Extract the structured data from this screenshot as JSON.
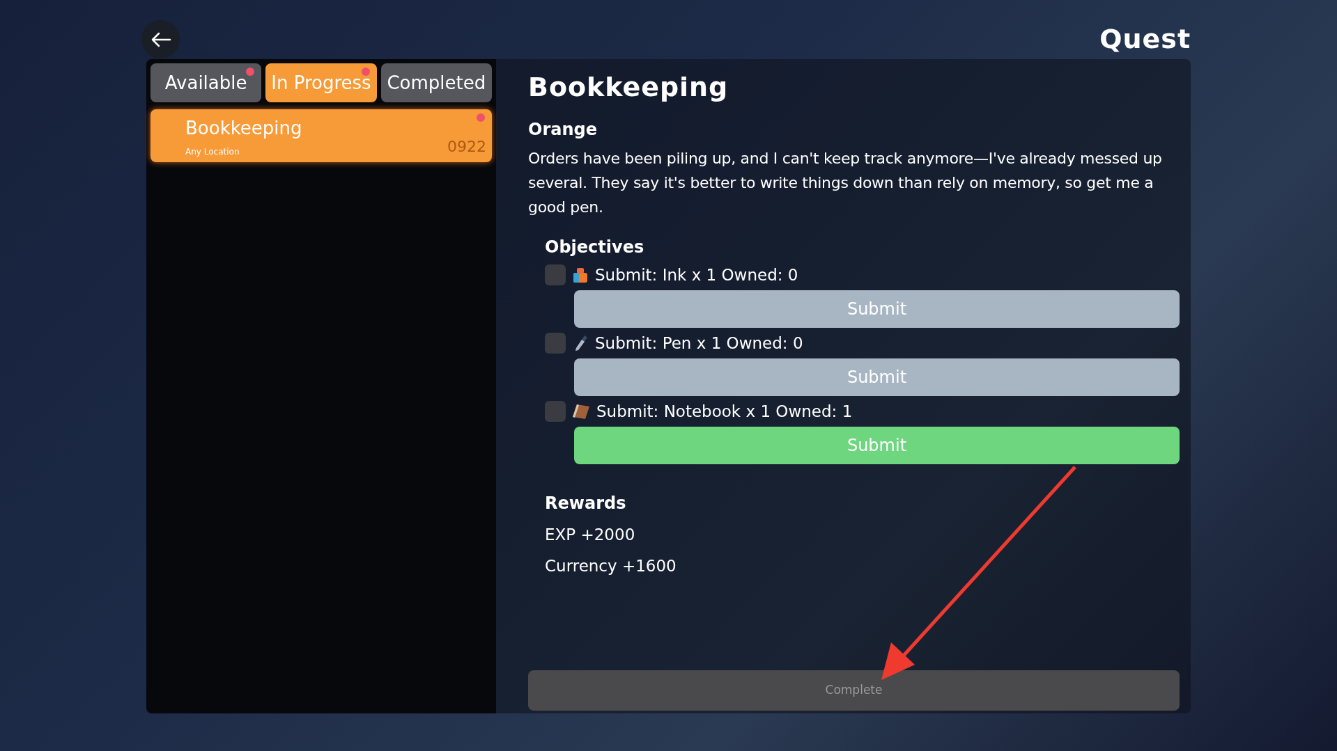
{
  "title": "Quest",
  "tabs": [
    {
      "label": "Available",
      "selected": false,
      "notification": true
    },
    {
      "label": "In Progress",
      "selected": true,
      "notification": true
    },
    {
      "label": "Completed",
      "selected": false,
      "notification": false
    }
  ],
  "quests": [
    {
      "name": "Bookkeeping",
      "location": "Any Location",
      "code": "0922",
      "selected": true,
      "notification": true
    }
  ],
  "detail": {
    "name": "Bookkeeping",
    "giver": "Orange",
    "description": "Orders have been piling up, and I can't keep track anymore—I've already messed up several. They say it's better to write things down than rely on memory, so get me a good pen.",
    "objectives_heading": "Objectives",
    "objectives": [
      {
        "kind": "ink",
        "text": "Submit: Ink x 1 Owned: 0",
        "checked": false,
        "button": "Submit",
        "disabled": true
      },
      {
        "kind": "pen",
        "text": "Submit: Pen x 1 Owned: 0",
        "checked": false,
        "button": "Submit",
        "disabled": true
      },
      {
        "kind": "notebook",
        "text": "Submit: Notebook x 1 Owned: 1",
        "checked": false,
        "button": "Submit",
        "disabled": false
      }
    ],
    "rewards_heading": "Rewards",
    "rewards": [
      "EXP +2000",
      "Currency +1600"
    ],
    "complete": {
      "label": "Complete",
      "disabled": true
    }
  }
}
